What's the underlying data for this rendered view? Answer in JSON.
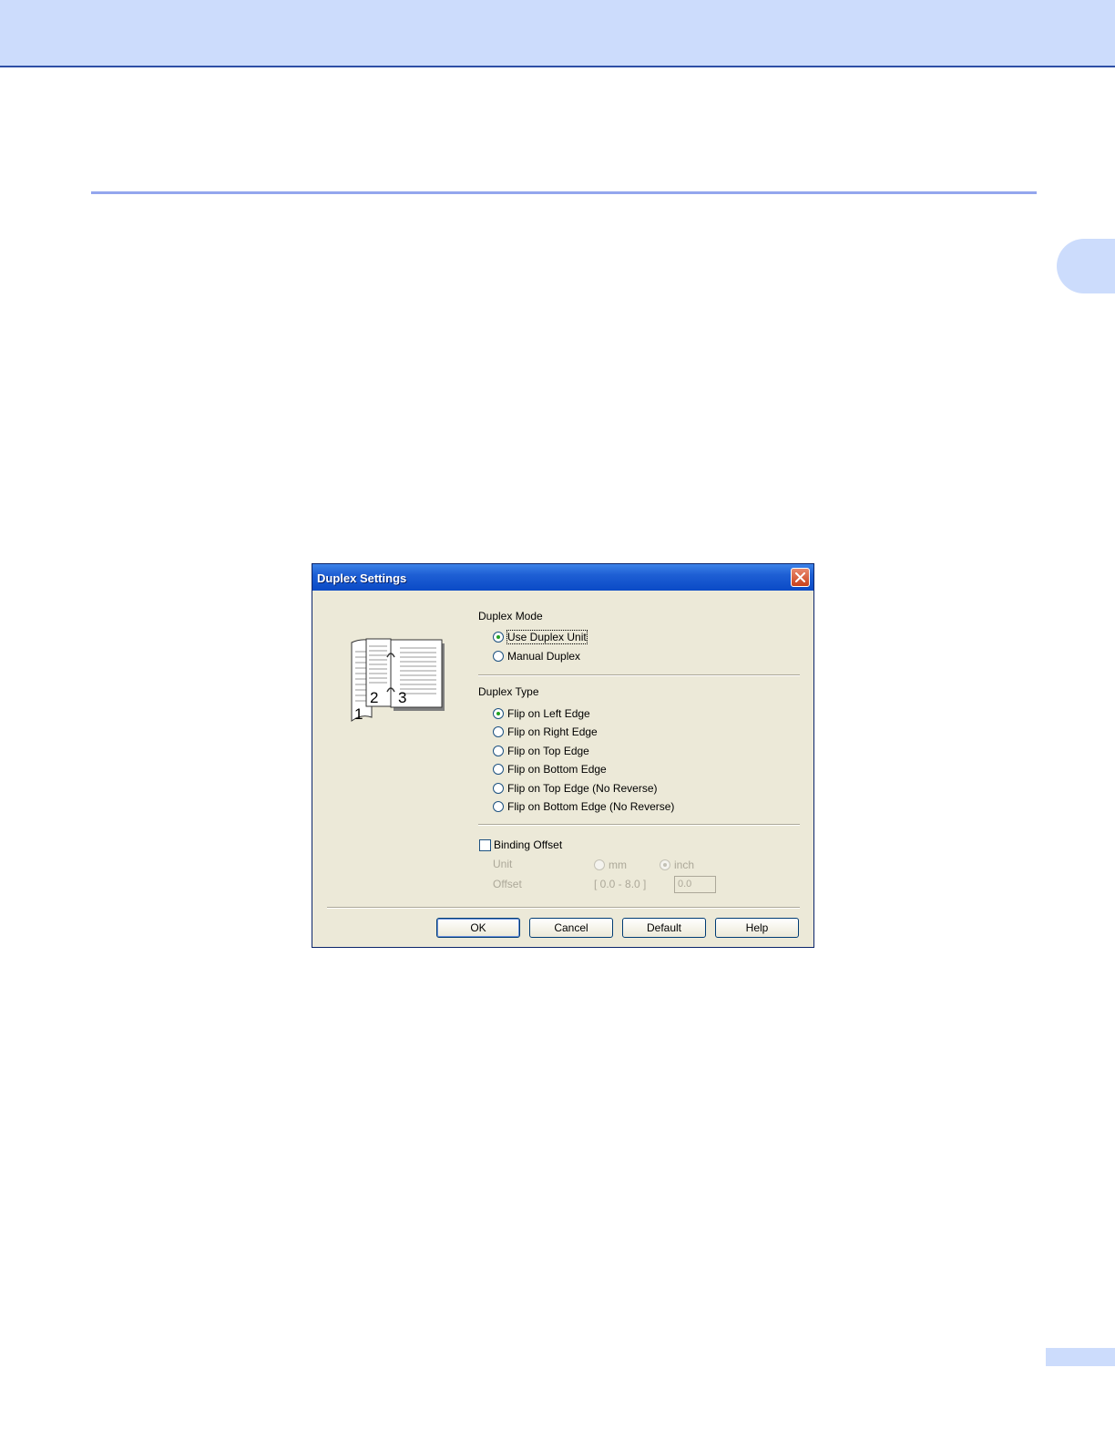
{
  "dialog": {
    "title": "Duplex Settings",
    "duplex_mode": {
      "label": "Duplex Mode",
      "options": [
        {
          "label": "Use Duplex Unit",
          "selected": true
        },
        {
          "label": "Manual Duplex",
          "selected": false
        }
      ]
    },
    "duplex_type": {
      "label": "Duplex Type",
      "options": [
        {
          "label": "Flip on Left Edge",
          "selected": true
        },
        {
          "label": "Flip on Right Edge",
          "selected": false
        },
        {
          "label": "Flip on Top Edge",
          "selected": false
        },
        {
          "label": "Flip on Bottom Edge",
          "selected": false
        },
        {
          "label": "Flip on Top Edge (No Reverse)",
          "selected": false
        },
        {
          "label": "Flip on Bottom Edge (No Reverse)",
          "selected": false
        }
      ]
    },
    "binding_offset": {
      "label": "Binding Offset",
      "checked": false,
      "unit_label": "Unit",
      "unit_mm": "mm",
      "unit_inch": "inch",
      "unit_selected": "inch",
      "offset_label": "Offset",
      "offset_range": "[ 0.0 - 8.0 ]",
      "offset_value": "0.0"
    },
    "illustration": {
      "page_numbers": [
        "1",
        "2",
        "3"
      ]
    },
    "buttons": {
      "ok": "OK",
      "cancel": "Cancel",
      "default": "Default",
      "help": "Help"
    }
  }
}
